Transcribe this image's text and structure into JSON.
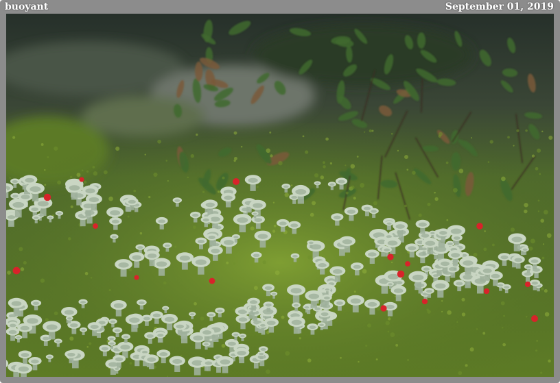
{
  "caption": {
    "title": "buoyant",
    "date": "September 01, 2019"
  },
  "photo": {
    "subject_icons": [
      "moss-bed",
      "cup-lichen-cluster",
      "red-fruiting-bodies",
      "leafy-shrub"
    ],
    "colors": {
      "background_dark": "#2a3327",
      "moss": "#6f8f2c",
      "moss_light": "#8fae3a",
      "lichen": "#c9d6c3",
      "lichen_shadow": "#9fb09b",
      "red_tips": "#d8232a",
      "leaves": "#3f6a2e",
      "frame": "#8c8c8c"
    }
  }
}
